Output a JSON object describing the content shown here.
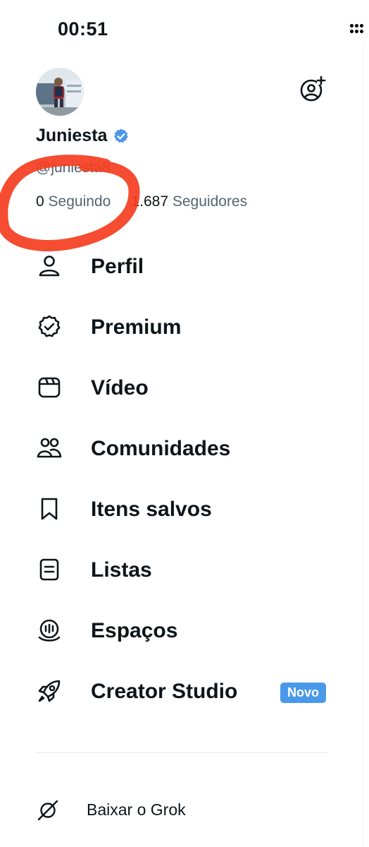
{
  "status_bar": {
    "time": "00:51"
  },
  "profile": {
    "display_name": "Juniesta",
    "handle": "@juniesta8",
    "following_count": "0",
    "following_label": "Seguindo",
    "followers_count": "1.687",
    "followers_label": "Seguidores",
    "verified": true
  },
  "menu": {
    "items": [
      {
        "label": "Perfil",
        "icon": "person-icon"
      },
      {
        "label": "Premium",
        "icon": "verified-badge-icon"
      },
      {
        "label": "Vídeo",
        "icon": "video-icon"
      },
      {
        "label": "Comunidades",
        "icon": "communities-icon"
      },
      {
        "label": "Itens salvos",
        "icon": "bookmark-icon"
      },
      {
        "label": "Listas",
        "icon": "list-icon"
      },
      {
        "label": "Espaços",
        "icon": "spaces-icon"
      },
      {
        "label": "Creator Studio",
        "icon": "rocket-icon",
        "badge": "Novo"
      }
    ]
  },
  "footer": {
    "grok_label": "Baixar o Grok",
    "grok_icon": "grok-icon"
  },
  "colors": {
    "accent": "#4a99e9",
    "annotation": "#f53d1f",
    "muted_text": "#536471"
  }
}
